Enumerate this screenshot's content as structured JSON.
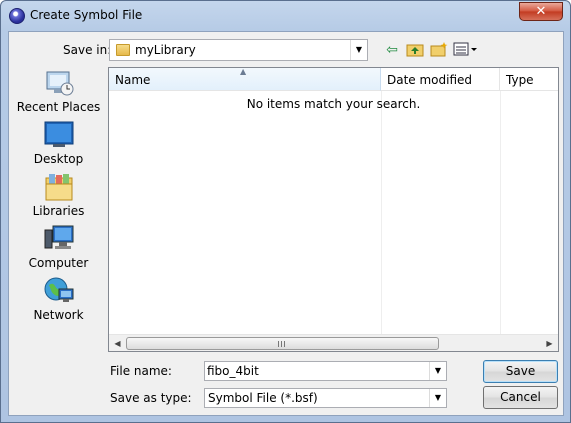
{
  "window": {
    "title": "Create Symbol File",
    "close_glyph": "✕",
    "app_icon": "globe-app-icon"
  },
  "toolbar": {
    "save_in_label": "Save in:",
    "save_in_value": "myLibrary",
    "back_icon": "back-arrow-icon",
    "up_icon": "up-folder-icon",
    "new_folder_icon": "new-folder-icon",
    "views_icon": "views-menu-icon"
  },
  "places": [
    {
      "label": "Recent Places",
      "icon": "recent-places-icon"
    },
    {
      "label": "Desktop",
      "icon": "desktop-icon"
    },
    {
      "label": "Libraries",
      "icon": "libraries-icon"
    },
    {
      "label": "Computer",
      "icon": "computer-icon"
    },
    {
      "label": "Network",
      "icon": "network-icon"
    }
  ],
  "filelist": {
    "columns": [
      "Name",
      "Date modified",
      "Type"
    ],
    "empty_message": "No items match your search."
  },
  "form": {
    "file_name_label": "File name:",
    "file_name_value": "fibo_4bit",
    "save_as_type_label": "Save as type:",
    "save_as_type_value": "Symbol File (*.bsf)"
  },
  "buttons": {
    "save": "Save",
    "cancel": "Cancel"
  },
  "colors": {
    "title_bar": "#b9cde6",
    "close_button": "#c9452a",
    "selection_header": "#e3f0fb"
  }
}
